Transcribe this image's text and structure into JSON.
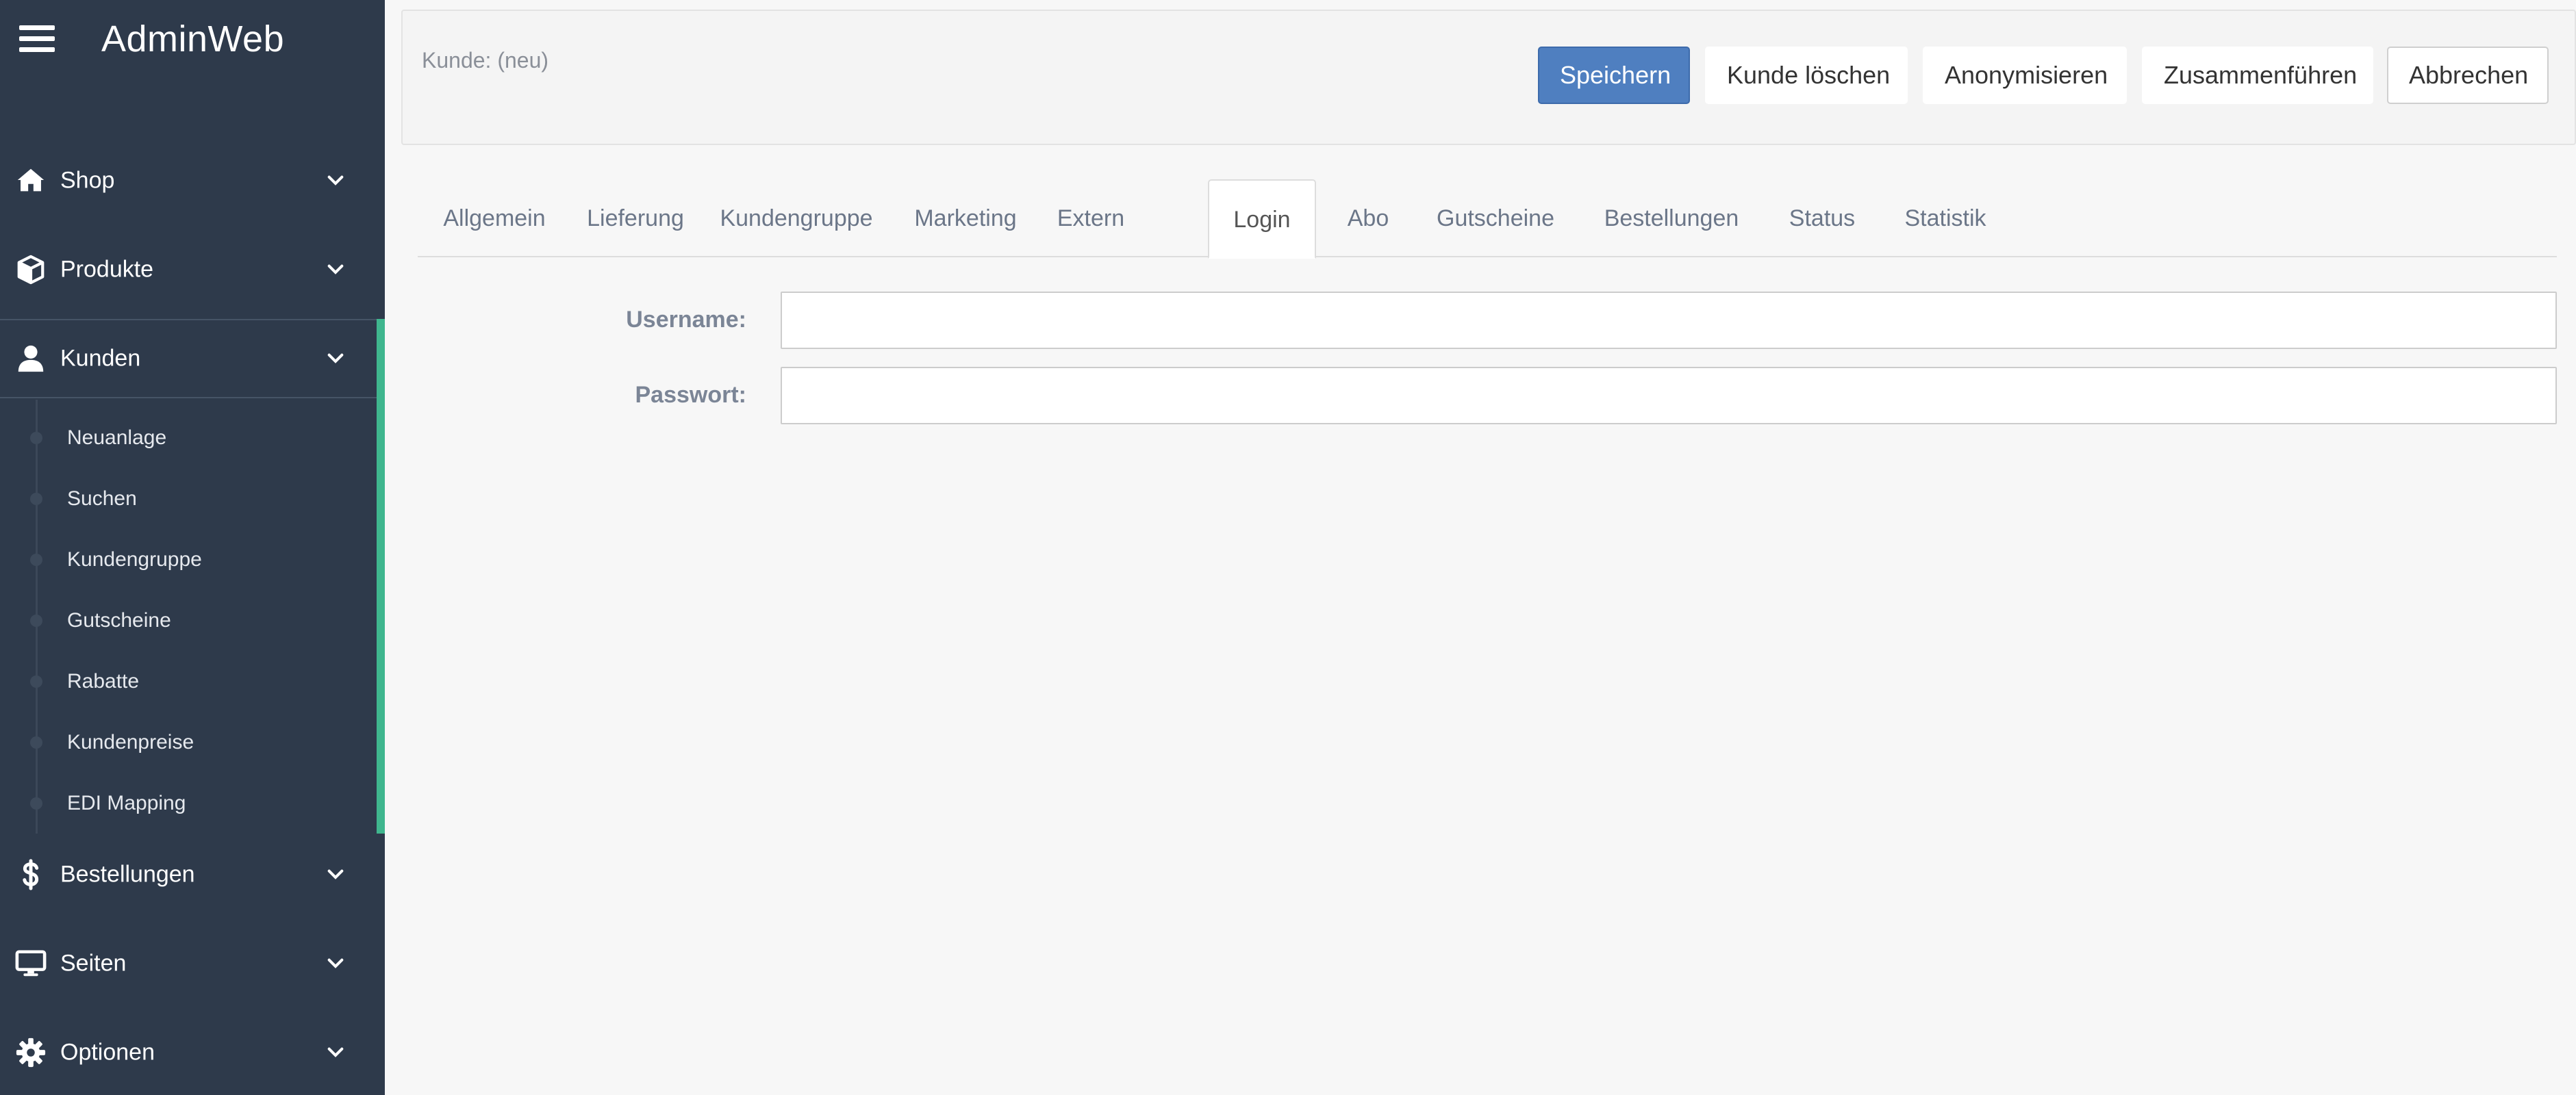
{
  "app": {
    "title": "AdminWeb"
  },
  "sidebar": {
    "items": [
      {
        "label": "Shop",
        "icon": "home-icon"
      },
      {
        "label": "Produkte",
        "icon": "cube-icon"
      },
      {
        "label": "Kunden",
        "icon": "user-icon",
        "active": true
      },
      {
        "label": "Bestellungen",
        "icon": "dollar-icon"
      },
      {
        "label": "Seiten",
        "icon": "monitor-icon"
      },
      {
        "label": "Optionen",
        "icon": "gear-icon"
      }
    ],
    "kunden_subitems": [
      "Neuanlage",
      "Suchen",
      "Kundengruppe",
      "Gutscheine",
      "Rabatte",
      "Kundenpreise",
      "EDI Mapping"
    ]
  },
  "header": {
    "record_title": "Kunde: (neu)",
    "buttons": {
      "save": "Speichern",
      "delete": "Kunde löschen",
      "anonymize": "Anonymisieren",
      "merge": "Zusammenführen",
      "cancel": "Abbrechen"
    }
  },
  "tabs": [
    "Allgemein",
    "Lieferung",
    "Kundengruppe",
    "Marketing",
    "Extern",
    "Login",
    "Abo",
    "Gutscheine",
    "Bestellungen",
    "Status",
    "Statistik"
  ],
  "active_tab": "Login",
  "form": {
    "username_label": "Username:",
    "username_value": "",
    "password_label": "Passwort:",
    "password_value": ""
  },
  "colors": {
    "sidebar_bg": "#2e3a4b",
    "accent_active": "#3fb68e",
    "primary_button": "#4f7fc0",
    "page_bg": "#f7f7f7"
  }
}
